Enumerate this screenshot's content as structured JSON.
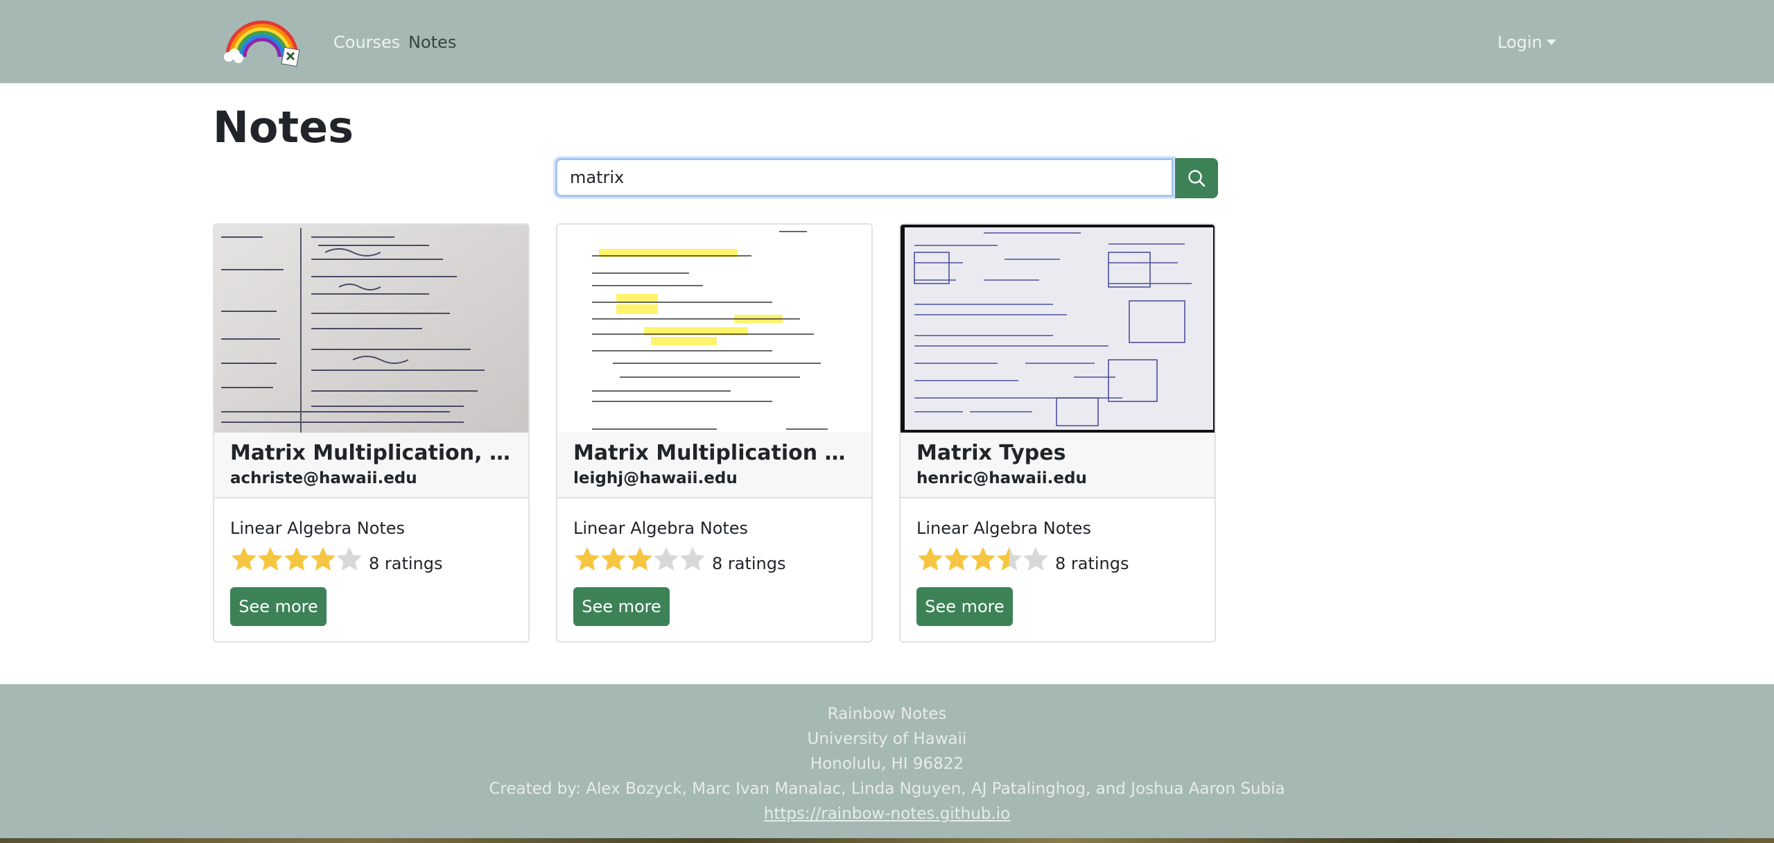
{
  "navbar": {
    "logo_icon": "rainbow-logo-icon",
    "links": [
      {
        "label": "Courses",
        "active": false
      },
      {
        "label": "Notes",
        "active": true
      }
    ],
    "login_label": "Login"
  },
  "main": {
    "title": "Notes",
    "search": {
      "value": "matrix",
      "button_icon": "search-icon"
    },
    "cards": [
      {
        "title": "Matrix Multiplication, Dot P...",
        "owner": "achriste@hawaii.edu",
        "course": "Linear Algebra Notes",
        "rating": 4,
        "ratings_label": "8 ratings",
        "button_label": "See more"
      },
      {
        "title": "Matrix Multiplication Exam...",
        "owner": "leighj@hawaii.edu",
        "course": "Linear Algebra Notes",
        "rating": 3,
        "ratings_label": "8 ratings",
        "button_label": "See more"
      },
      {
        "title": "Matrix Types",
        "owner": "henric@hawaii.edu",
        "course": "Linear Algebra Notes",
        "rating": 3.5,
        "ratings_label": "8 ratings",
        "button_label": "See more"
      }
    ]
  },
  "footer": {
    "lines": [
      "Rainbow Notes",
      "University of Hawaii",
      "Honolulu, HI 96822",
      "Created by: Alex Bozyck, Marc Ivan Manalac, Linda Nguyen, AJ Patalinghog, and Joshua Aaron Subia"
    ],
    "link": "https://rainbow-notes.github.io"
  },
  "colors": {
    "navbar": "#a5b8b4",
    "button": "#3d8257",
    "star_on": "#f6c542",
    "star_off": "#d8d8d8"
  }
}
